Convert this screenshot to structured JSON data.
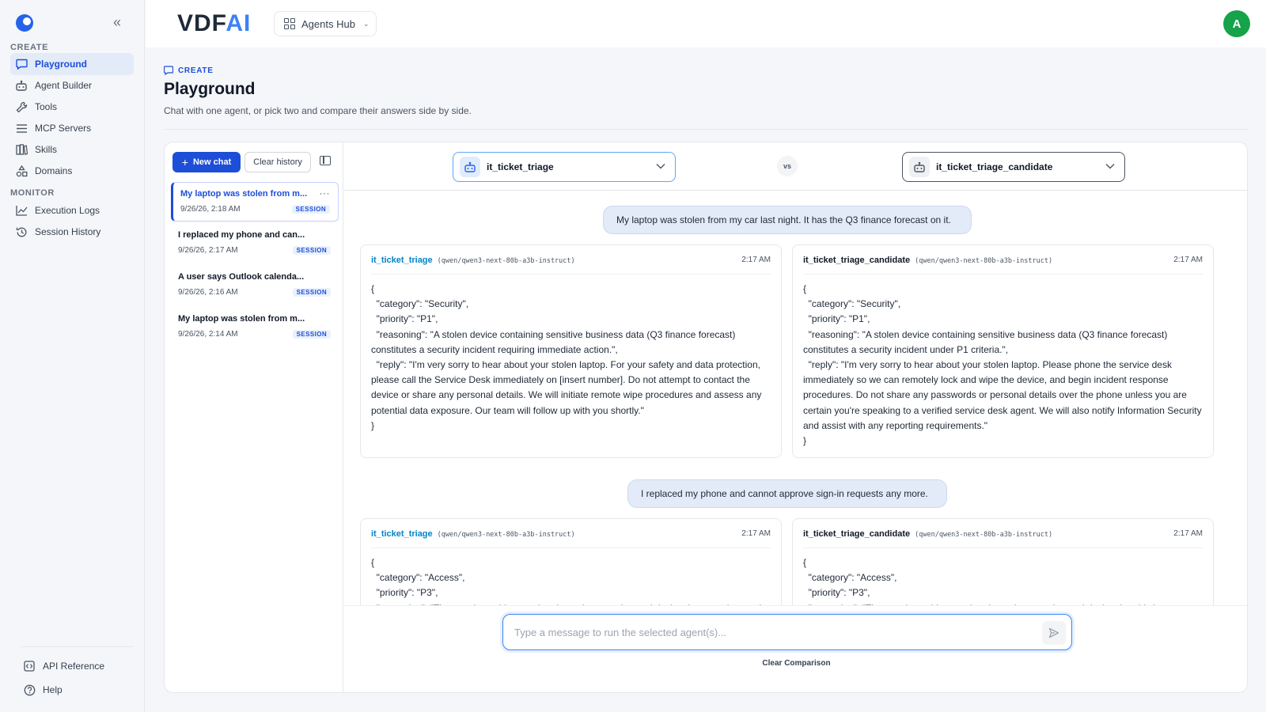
{
  "sidebar": {
    "sections": [
      {
        "label": "CREATE"
      },
      {
        "label": "MONITOR"
      }
    ],
    "create_items": [
      {
        "label": "Playground",
        "icon": "chat-icon",
        "active": true
      },
      {
        "label": "Agent Builder",
        "icon": "robot-icon"
      },
      {
        "label": "Tools",
        "icon": "wrench-icon"
      },
      {
        "label": "MCP Servers",
        "icon": "server-icon"
      },
      {
        "label": "Skills",
        "icon": "book-icon"
      },
      {
        "label": "Domains",
        "icon": "shapes-icon"
      }
    ],
    "monitor_items": [
      {
        "label": "Execution Logs",
        "icon": "chart-line-icon"
      },
      {
        "label": "Session History",
        "icon": "history-icon"
      }
    ],
    "footer_items": [
      {
        "label": "API Reference",
        "icon": "api-icon"
      },
      {
        "label": "Help",
        "icon": "help-icon"
      }
    ]
  },
  "topbar": {
    "brand_main": "VDF",
    "brand_accent": "AI",
    "hub_label": "Agents Hub",
    "avatar_initial": "A"
  },
  "page": {
    "crumb": "CREATE",
    "title": "Playground",
    "subtitle": "Chat with one agent, or pick two and compare their answers side by side."
  },
  "chat_list": {
    "new_chat_label": "New chat",
    "clear_history_label": "Clear history",
    "items": [
      {
        "title": "My laptop was stolen from m...",
        "date": "9/26/26, 2:18 AM",
        "badge": "SESSION",
        "active": true
      },
      {
        "title": "I replaced my phone and can...",
        "date": "9/26/26, 2:17 AM",
        "badge": "SESSION"
      },
      {
        "title": "A user says Outlook calenda...",
        "date": "9/26/26, 2:16 AM",
        "badge": "SESSION"
      },
      {
        "title": "My laptop was stolen from m...",
        "date": "9/26/26, 2:14 AM",
        "badge": "SESSION"
      }
    ]
  },
  "compare": {
    "agent_a": "it_ticket_triage",
    "agent_b": "it_ticket_triage_candidate",
    "vs_label": "vs",
    "turns": [
      {
        "user": "My laptop was stolen from my car last night. It has the Q3 finance forecast on it.",
        "responses": [
          {
            "agent": "it_ticket_triage",
            "model": "(qwen/qwen3-next-80b-a3b-instruct)",
            "time": "2:17 AM",
            "body": "{\n  \"category\": \"Security\",\n  \"priority\": \"P1\",\n  \"reasoning\": \"A stolen device containing sensitive business data (Q3 finance forecast) constitutes a security incident requiring immediate action.\",\n  \"reply\": \"I'm very sorry to hear about your stolen laptop. For your safety and data protection, please call the Service Desk immediately on [insert number]. Do not attempt to contact the device or share any personal details. We will initiate remote wipe procedures and assess any potential data exposure. Our team will follow up with you shortly.\"\n}"
          },
          {
            "agent": "it_ticket_triage_candidate",
            "model": "(qwen/qwen3-next-80b-a3b-instruct)",
            "time": "2:17 AM",
            "body": "{\n  \"category\": \"Security\",\n  \"priority\": \"P1\",\n  \"reasoning\": \"A stolen device containing sensitive business data (Q3 finance forecast) constitutes a security incident under P1 criteria.\",\n  \"reply\": \"I'm very sorry to hear about your stolen laptop. Please phone the service desk immediately so we can remotely lock and wipe the device, and begin incident response procedures. Do not share any passwords or personal details over the phone unless you are certain you're speaking to a verified service desk agent. We will also notify Information Security and assist with any reporting requirements.\"\n}"
          }
        ]
      },
      {
        "user": "I replaced my phone and cannot approve sign-in requests any more.",
        "responses": [
          {
            "agent": "it_ticket_triage",
            "model": "(qwen/qwen3-next-80b-a3b-instruct)",
            "time": "2:17 AM",
            "body": "{\n  \"category\": \"Access\",\n  \"priority\": \"P3\",\n  \"reasoning\": \"The user is unable to authenticate due to a changed device, but a workaround"
          },
          {
            "agent": "it_ticket_triage_candidate",
            "model": "(qwen/qwen3-next-80b-a3b-instruct)",
            "time": "2:17 AM",
            "body": "{\n  \"category\": \"Access\",\n  \"priority\": \"P3\",\n  \"reasoning\": \"The user is unable to authenticate due to a changed device, but this is a"
          }
        ]
      }
    ],
    "input_placeholder": "Type a message to run the selected agent(s)...",
    "clear_comparison_label": "Clear Comparison"
  },
  "colors": {
    "accent": "#1d4ed8",
    "agent_a_name": "#0284c7",
    "avatar": "#16a34a",
    "user_bubble": "#e3ebf8"
  }
}
